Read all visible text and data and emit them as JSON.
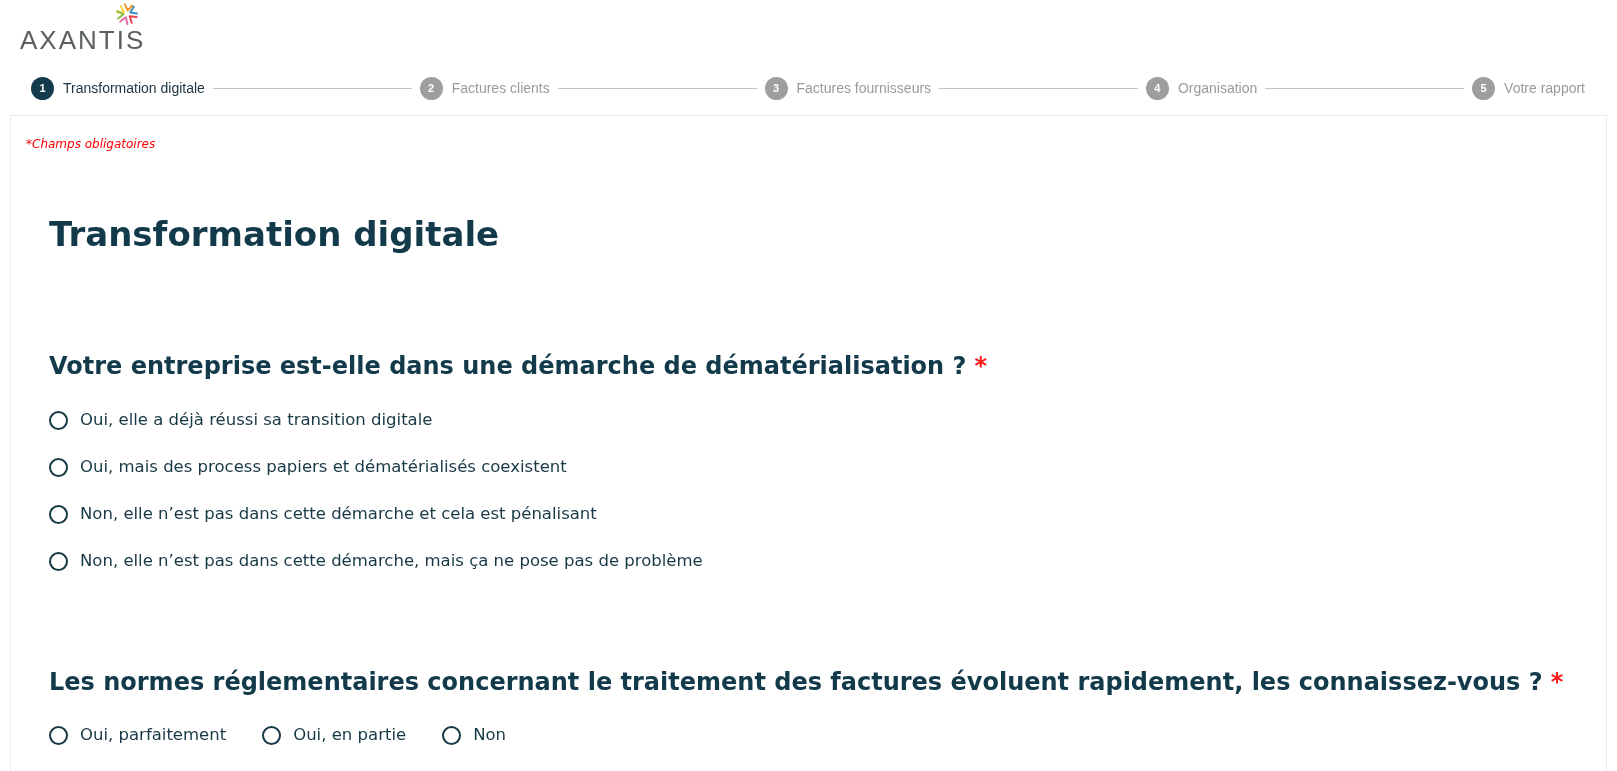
{
  "logo": {
    "text": "AXANTIS"
  },
  "stepper": [
    {
      "number": "1",
      "label": "Transformation digitale",
      "selected": true
    },
    {
      "number": "2",
      "label": "Factures clients",
      "selected": false
    },
    {
      "number": "3",
      "label": "Factures fournisseurs",
      "selected": false
    },
    {
      "number": "4",
      "label": "Organisation",
      "selected": false
    },
    {
      "number": "5",
      "label": "Votre rapport",
      "selected": false
    }
  ],
  "required_note": "*Champs obligatoires",
  "section_title": "Transformation digitale",
  "questions": [
    {
      "text": "Votre entreprise est-elle dans une démarche de dématérialisation ?",
      "required_mark": "*",
      "kind": "stacked",
      "options": [
        {
          "label": "Oui, elle a déjà réussi sa transition digitale",
          "selected": false
        },
        {
          "label": "Oui, mais des process papiers et dématérialisés coexistent",
          "selected": false
        },
        {
          "label": "Non, elle n’est pas dans cette démarche et cela est pénalisant",
          "selected": false
        },
        {
          "label": "Non, elle n’est pas dans cette démarche, mais ça ne pose pas de problème",
          "selected": false
        }
      ]
    },
    {
      "text": "Les normes réglementaires concernant le traitement des factures évoluent rapidement, les connaissez-vous ?",
      "required_mark": "*",
      "kind": "inline",
      "options": [
        {
          "label": "Oui, parfaitement",
          "selected": false
        },
        {
          "label": "Oui, en partie",
          "selected": false
        },
        {
          "label": "Non",
          "selected": false
        }
      ]
    }
  ]
}
